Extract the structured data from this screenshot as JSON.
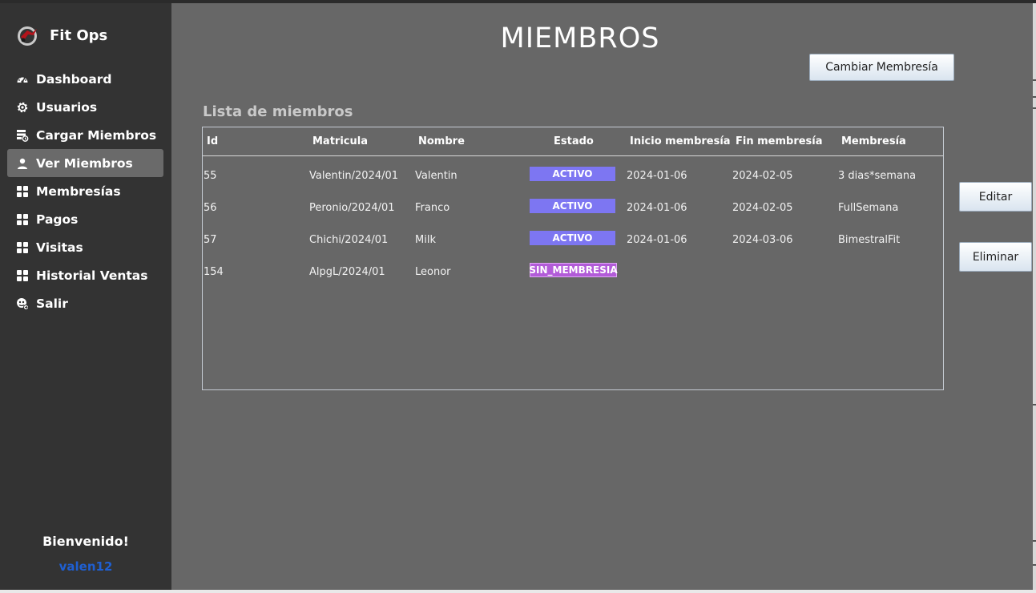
{
  "app": {
    "title": "Fit Ops"
  },
  "colors": {
    "sidebar": "#333333",
    "main": "#676767",
    "accent_link": "#1f5fd1",
    "badge_activo": "#7d76f2",
    "badge_sin": "#b25bd8"
  },
  "sidebar": {
    "items": [
      {
        "label": "Dashboard",
        "icon": "dashboard-gauge-icon",
        "active": false
      },
      {
        "label": "Usuarios",
        "icon": "gear-icon",
        "active": false
      },
      {
        "label": "Cargar Miembros",
        "icon": "upload-list-icon",
        "active": false
      },
      {
        "label": "Ver Miembros",
        "icon": "user-icon",
        "active": true
      },
      {
        "label": "Membresías",
        "icon": "grid-icon",
        "active": false
      },
      {
        "label": "Pagos",
        "icon": "grid-icon",
        "active": false
      },
      {
        "label": "Visitas",
        "icon": "grid-icon",
        "active": false
      },
      {
        "label": "Historial Ventas",
        "icon": "grid-icon",
        "active": false
      },
      {
        "label": "Salir",
        "icon": "logout-icon",
        "active": false
      }
    ],
    "welcome": "Bienvenido!",
    "username": "valen12"
  },
  "main": {
    "title": "MIEMBROS",
    "cambiar_button": "Cambiar Membresía",
    "section_label": "Lista de miembros",
    "editar_button": "Editar",
    "eliminar_button": "Eliminar",
    "table": {
      "headers": [
        "Id",
        "Matricula",
        "Nombre",
        "Estado",
        "Inicio membresía",
        "Fin membresía",
        "Membresía"
      ],
      "rows": [
        {
          "id": "55",
          "matricula": "Valentin/2024/01",
          "nombre": "Valentin",
          "estado": "ACTIVO",
          "inicio": "2024-01-06",
          "fin": "2024-02-05",
          "membresia": "3 dias*semana"
        },
        {
          "id": "56",
          "matricula": "Peronio/2024/01",
          "nombre": "Franco",
          "estado": "ACTIVO",
          "inicio": "2024-01-06",
          "fin": "2024-02-05",
          "membresia": "FullSemana"
        },
        {
          "id": "57",
          "matricula": "Chichi/2024/01",
          "nombre": "Milk",
          "estado": "ACTIVO",
          "inicio": "2024-01-06",
          "fin": "2024-03-06",
          "membresia": "BimestralFit"
        },
        {
          "id": "154",
          "matricula": "AlpgL/2024/01",
          "nombre": "Leonor",
          "estado": "SIN_MEMBRESIA",
          "inicio": "",
          "fin": "",
          "membresia": ""
        }
      ]
    }
  }
}
